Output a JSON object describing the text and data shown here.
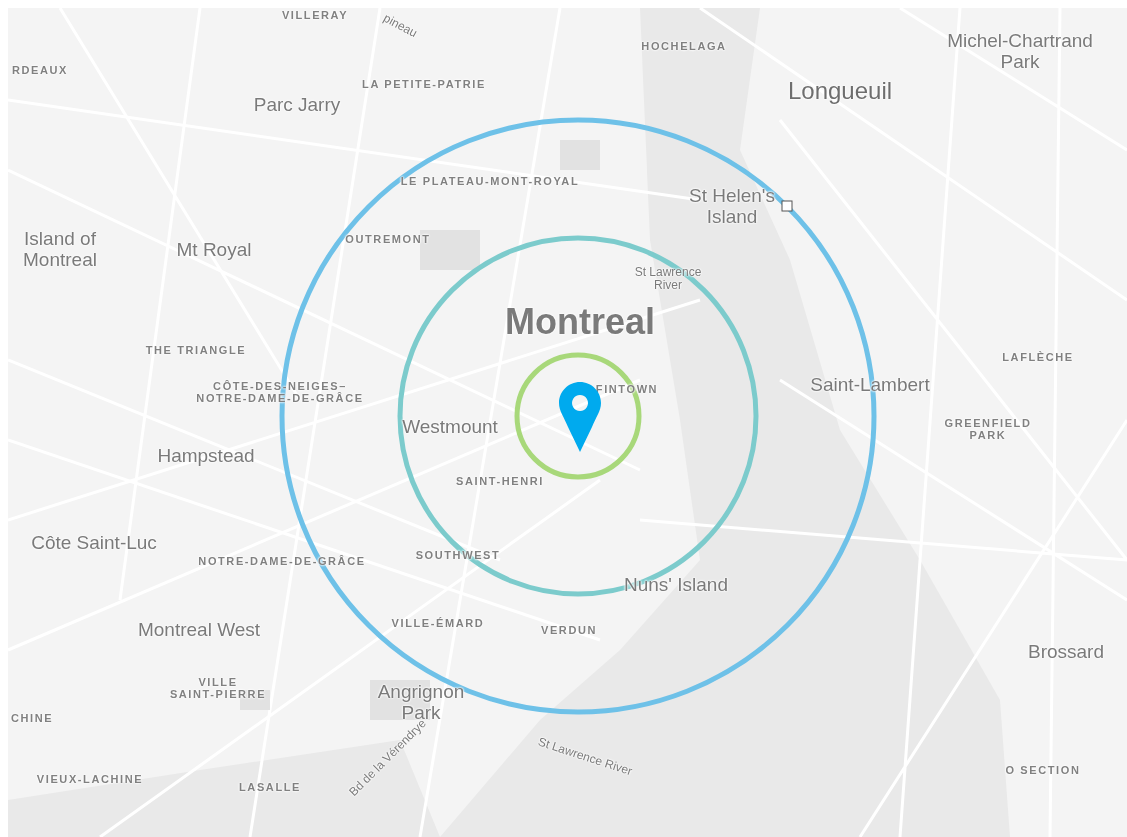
{
  "map": {
    "labels": [
      {
        "text": "VILLERAY",
        "kind": "district"
      },
      {
        "text": "pineau",
        "kind": "road"
      },
      {
        "text": "HOCHELAGA",
        "kind": "district"
      },
      {
        "text": "RDEAUX",
        "kind": "district"
      },
      {
        "text": "Michel-Chartrand\nPark",
        "kind": "place"
      },
      {
        "text": "LA PETITE-PATRIE",
        "kind": "district"
      },
      {
        "text": "Parc Jarry",
        "kind": "place"
      },
      {
        "text": "Longueuil",
        "kind": "city"
      },
      {
        "text": "LE PLATEAU-MONT-ROYAL",
        "kind": "district"
      },
      {
        "text": "St Helen's\nIsland",
        "kind": "place"
      },
      {
        "text": "Island of\nMontreal",
        "kind": "place"
      },
      {
        "text": "Mt Royal",
        "kind": "place"
      },
      {
        "text": "OUTREMONT",
        "kind": "district"
      },
      {
        "text": "St Lawrence\nRiver",
        "kind": "water"
      },
      {
        "text": "THE TRIANGLE",
        "kind": "district"
      },
      {
        "text": "Montreal",
        "kind": "capital"
      },
      {
        "text": "LAFLÈCHE",
        "kind": "district"
      },
      {
        "text": "CÔTE-DES-NEIGES–\nNOTRE-DAME-DE-GRÂCE",
        "kind": "district"
      },
      {
        "text": "FINTOWN",
        "kind": "district"
      },
      {
        "text": "Saint-Lambert",
        "kind": "place"
      },
      {
        "text": "Westmount",
        "kind": "place"
      },
      {
        "text": "GREENFIELD\nPARK",
        "kind": "district"
      },
      {
        "text": "Hampstead",
        "kind": "place"
      },
      {
        "text": "SAINT-HENRI",
        "kind": "district"
      },
      {
        "text": "Côte Saint-Luc",
        "kind": "place"
      },
      {
        "text": "NOTRE-DAME-DE-GRÂCE",
        "kind": "district"
      },
      {
        "text": "SOUTHWEST",
        "kind": "district"
      },
      {
        "text": "Nuns' Island",
        "kind": "place"
      },
      {
        "text": "Montreal West",
        "kind": "place"
      },
      {
        "text": "VILLE-ÉMARD",
        "kind": "district"
      },
      {
        "text": "VERDUN",
        "kind": "district"
      },
      {
        "text": "Brossard",
        "kind": "place"
      },
      {
        "text": "VILLE\nSAINT-PIERRE",
        "kind": "district"
      },
      {
        "text": "CHINE",
        "kind": "district"
      },
      {
        "text": "Angrignon\nPark",
        "kind": "place"
      },
      {
        "text": "VIEUX-LACHINE",
        "kind": "district"
      },
      {
        "text": "LASALLE",
        "kind": "district"
      },
      {
        "text": "Bd de la Vérendrye",
        "kind": "road"
      },
      {
        "text": "St Lawrence River",
        "kind": "water"
      },
      {
        "text": "O SECTION",
        "kind": "district"
      }
    ],
    "rings": [
      {
        "color": "#6ec1e8"
      },
      {
        "color": "#7ccbcc"
      },
      {
        "color": "#a8d87a"
      }
    ],
    "pin": {
      "color": "#00aaee"
    }
  }
}
